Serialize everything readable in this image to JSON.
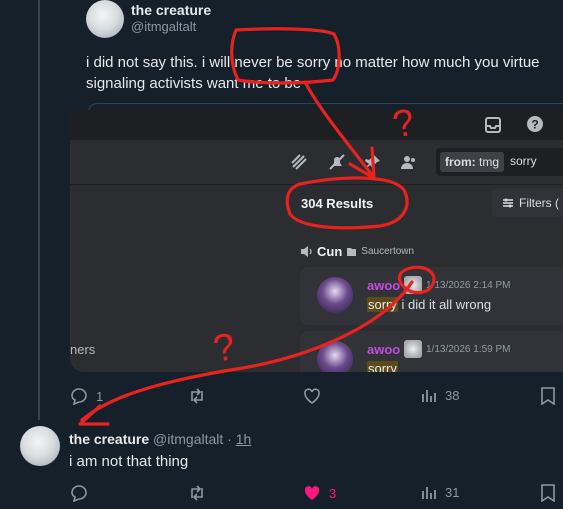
{
  "original_tweet": {
    "display_name": "the creature",
    "handle": "@itmgaltalt",
    "text_line1": "i did not say this. i will never be sorry no matter how much you virtue",
    "text_line2": "signaling activists want me to be"
  },
  "discord": {
    "search_from_label": "from:",
    "search_from_value": "tmg",
    "search_query": "sorry",
    "results_label": "304 Results",
    "filters_label": "Filters (",
    "channel_name": "Cun",
    "server_name": "Saucertown",
    "left_snippet": "ners",
    "results": [
      {
        "author": "awoo",
        "timestamp": "1/13/2026 2:14 PM",
        "highlight": "sorry",
        "rest": " i did it all wrong"
      },
      {
        "author": "awoo",
        "timestamp": "1/13/2026 1:59 PM",
        "highlight": "sorry",
        "rest": ""
      }
    ]
  },
  "tweet1_actions": {
    "replies": "1",
    "reposts": "",
    "likes": "",
    "views": "38"
  },
  "reply_tweet": {
    "display_name": "the creature",
    "handle": "@itmgaltalt",
    "separator": "·",
    "time": "1h",
    "text": "i am not that thing",
    "replies": "",
    "reposts": "",
    "likes": "3",
    "views": "31"
  },
  "annotation": {
    "color": "#e8231f",
    "question_mark": "?"
  },
  "colors": {
    "background": "#15202b",
    "discord_bg": "#313338",
    "like_pink": "#f91880",
    "author_purple": "#c54be0"
  }
}
